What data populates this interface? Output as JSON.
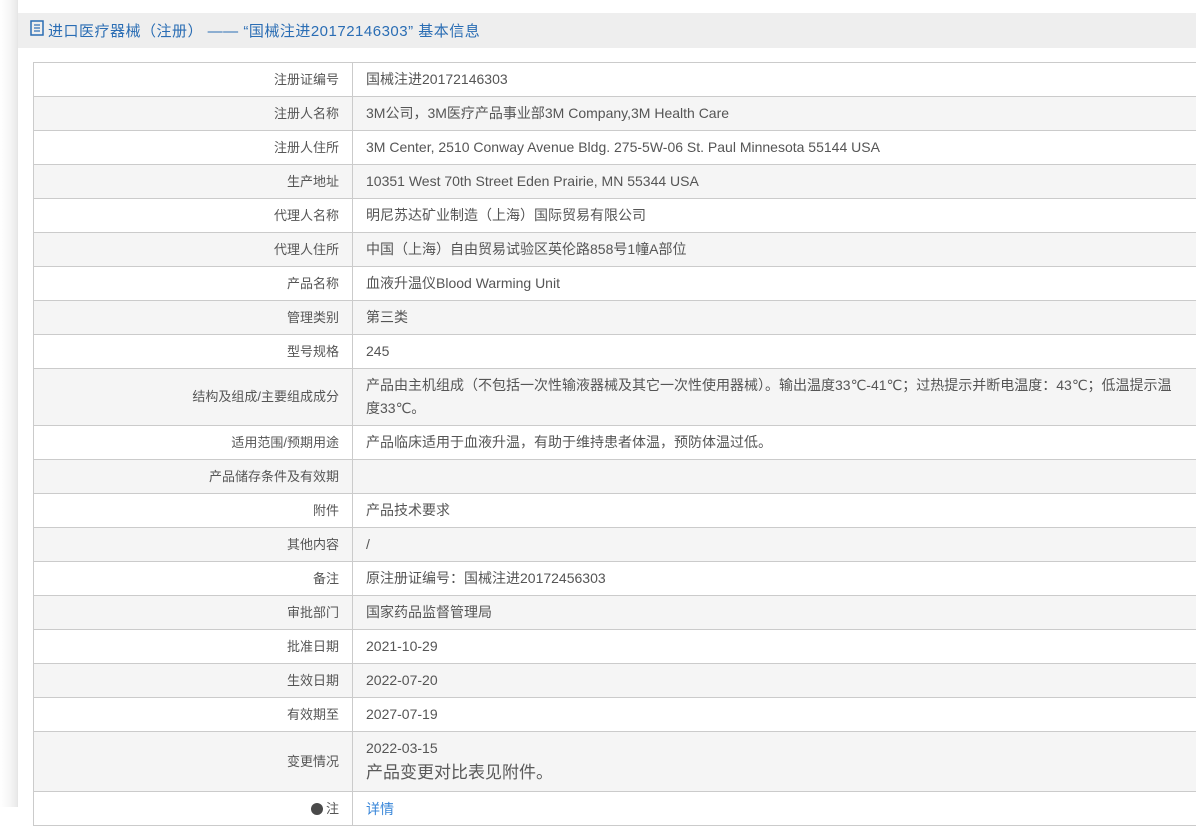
{
  "colors": {
    "header_bg": "#eeeeee",
    "header_text": "#2a6db4",
    "border": "#cbcbcb",
    "stripe": "#f5f5f5",
    "text": "#555555",
    "link": "#3a87d9"
  },
  "header": {
    "icon": "document-icon",
    "title": "进口医疗器械（注册） —— “国械注进20172146303” 基本信息"
  },
  "table": {
    "rows": [
      {
        "label": "注册证编号",
        "value": "国械注进20172146303"
      },
      {
        "label": "注册人名称",
        "value": "3M公司，3M医疗产品事业部3M Company,3M Health Care"
      },
      {
        "label": "注册人住所",
        "value": "3M Center, 2510 Conway Avenue Bldg. 275-5W-06 St. Paul Minnesota 55144 USA"
      },
      {
        "label": "生产地址",
        "value": "10351 West 70th Street Eden Prairie, MN 55344 USA"
      },
      {
        "label": "代理人名称",
        "value": "明尼苏达矿业制造（上海）国际贸易有限公司"
      },
      {
        "label": "代理人住所",
        "value": "中国（上海）自由贸易试验区英伦路858号1幢A部位"
      },
      {
        "label": "产品名称",
        "value": "血液升温仪Blood Warming Unit"
      },
      {
        "label": "管理类别",
        "value": "第三类"
      },
      {
        "label": "型号规格",
        "value": "245"
      },
      {
        "label": "结构及组成/主要组成成分",
        "value": "产品由主机组成（不包括一次性输液器械及其它一次性使用器械）。输出温度33℃-41℃；过热提示并断电温度：43℃；低温提示温度33℃。"
      },
      {
        "label": "适用范围/预期用途",
        "value": "产品临床适用于血液升温，有助于维持患者体温，预防体温过低。"
      },
      {
        "label": "产品储存条件及有效期",
        "value": ""
      },
      {
        "label": "附件",
        "value": "产品技术要求"
      },
      {
        "label": "其他内容",
        "value": "/"
      },
      {
        "label": "备注",
        "value": "原注册证编号：国械注进20172456303"
      },
      {
        "label": "审批部门",
        "value": "国家药品监督管理局"
      },
      {
        "label": "批准日期",
        "value": "2021-10-29"
      },
      {
        "label": "生效日期",
        "value": "2022-07-20"
      },
      {
        "label": "有效期至",
        "value": "2027-07-19"
      },
      {
        "label": "变更情况",
        "value_lines": [
          "2022-03-15",
          "产品变更对比表见附件。"
        ]
      },
      {
        "label": "注",
        "label_icon": "note-circle-icon",
        "link": "详情"
      }
    ]
  }
}
